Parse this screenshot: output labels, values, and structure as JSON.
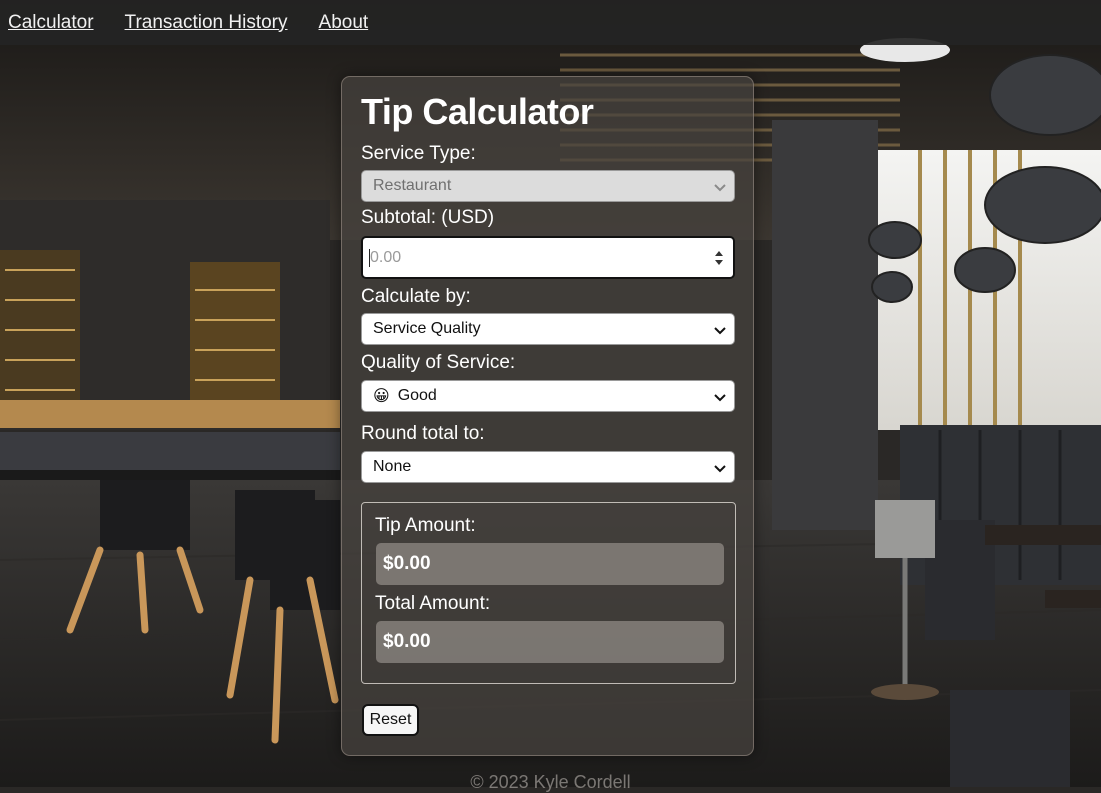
{
  "nav": {
    "items": [
      {
        "label": "Calculator"
      },
      {
        "label": "Transaction History"
      },
      {
        "label": "About"
      }
    ]
  },
  "card": {
    "title": "Tip Calculator",
    "service_type": {
      "label": "Service Type:",
      "value": "Restaurant"
    },
    "subtotal": {
      "label": "Subtotal: (USD)",
      "placeholder": "0.00"
    },
    "calculate_by": {
      "label": "Calculate by:",
      "value": "Service Quality"
    },
    "quality": {
      "label": "Quality of Service:",
      "emoji": "😀",
      "value": "Good"
    },
    "round_total": {
      "label": "Round total to:",
      "value": "None"
    },
    "results": {
      "tip_label": "Tip Amount:",
      "tip_value": "$0.00",
      "total_label": "Total Amount:",
      "total_value": "$0.00"
    },
    "reset_label": "Reset"
  },
  "footer": {
    "text": "© 2023 Kyle Cordell"
  },
  "icons": {
    "select_arrow": "chevron-down-icon",
    "number_spinner": "spinner-arrows-icon"
  },
  "colors": {
    "card_bg": "#46423e",
    "nav_bg": "#242424",
    "text": "#ffffff"
  }
}
